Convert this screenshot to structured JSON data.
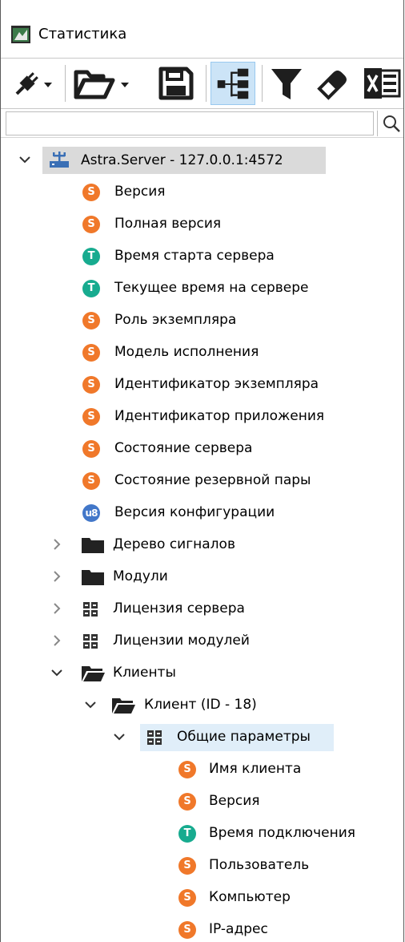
{
  "window": {
    "title": "Статистика"
  },
  "toolbar": {
    "icons": [
      "plug-icon",
      "dropdown-arrow-icon",
      "folder-open-icon",
      "dropdown-arrow-icon",
      "save-icon",
      "tree-view-icon",
      "filter-icon",
      "eraser-icon",
      "excel-icon"
    ]
  },
  "search": {
    "value": "",
    "placeholder": ""
  },
  "tree": {
    "server": {
      "label": "Astra.Server - 127.0.0.1:4572"
    },
    "items": [
      {
        "type": "S",
        "label": "Версия"
      },
      {
        "type": "S",
        "label": "Полная версия"
      },
      {
        "type": "T",
        "label": "Время старта сервера"
      },
      {
        "type": "T",
        "label": "Текущее время на сервере"
      },
      {
        "type": "S",
        "label": "Роль экземпляра"
      },
      {
        "type": "S",
        "label": "Модель исполнения"
      },
      {
        "type": "S",
        "label": "Идентификатор экземпляра"
      },
      {
        "type": "S",
        "label": "Идентификатор приложения"
      },
      {
        "type": "S",
        "label": "Состояние сервера"
      },
      {
        "type": "S",
        "label": "Состояние резервной пары"
      },
      {
        "type": "u8",
        "label": "Версия конфигурации"
      }
    ],
    "groups": [
      {
        "label": "Дерево сигналов"
      },
      {
        "label": "Модули"
      },
      {
        "label": "Лицензия сервера"
      },
      {
        "label": "Лицензии модулей"
      },
      {
        "label": "Клиенты"
      }
    ],
    "client": {
      "label": "Клиент (ID - 18)"
    },
    "params": {
      "label": "Общие параметры"
    },
    "param_items": [
      {
        "type": "S",
        "label": "Имя клиента"
      },
      {
        "type": "S",
        "label": "Версия"
      },
      {
        "type": "T",
        "label": "Время подключения"
      },
      {
        "type": "S",
        "label": "Пользователь"
      },
      {
        "type": "S",
        "label": "Компьютер"
      },
      {
        "type": "S",
        "label": "IP-адрес"
      }
    ]
  },
  "badges": {
    "S": "S",
    "T": "T",
    "u8": "u8"
  },
  "colors": {
    "string_badge": "#f0782a",
    "time_badge": "#17ab8f",
    "uint_badge": "#4277c9",
    "selection": "#dadada",
    "hover": "#e0eef9"
  }
}
